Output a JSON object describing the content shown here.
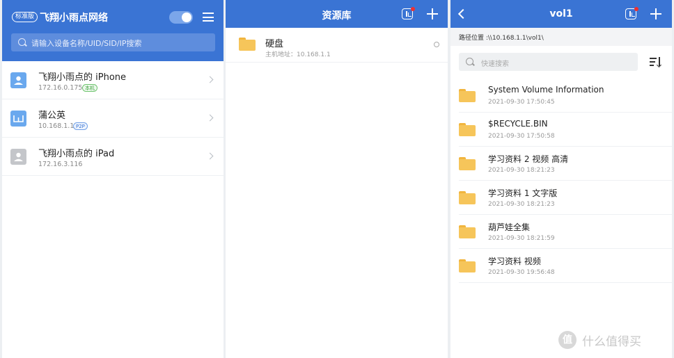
{
  "panel_left": {
    "badge": "标准版",
    "title": "飞翔小雨点网络",
    "search_placeholder": "请输入设备名称/UID/SID/IP搜索",
    "devices": [
      {
        "name": "飞翔小雨点的 iPhone",
        "ip": "172.16.0.175",
        "tag": "本机",
        "tag_color": "green",
        "icon": "phone-icon"
      },
      {
        "name": "蒲公英",
        "ip": "10.168.1.1",
        "tag": "P2P",
        "tag_color": "blue",
        "icon": "router-icon"
      },
      {
        "name": "飞翔小雨点的 iPad",
        "ip": "172.16.3.116",
        "tag": "",
        "tag_color": "",
        "icon": "tablet-icon"
      }
    ]
  },
  "panel_middle": {
    "title": "资源库",
    "disk": {
      "name": "硬盘",
      "host": "主机地址：10.168.1.1"
    }
  },
  "panel_right": {
    "title": "vol1",
    "path": "路径位置 :\\\\10.168.1.1\\vol1\\",
    "search_placeholder": "快速搜索",
    "files": [
      {
        "name": "System Volume Information",
        "date": "2021-09-30 17:50:45"
      },
      {
        "name": "$RECYCLE.BIN",
        "date": "2021-09-30 17:50:58"
      },
      {
        "name": "学习资料 2 视频 高清",
        "date": "2021-09-30 18:21:23"
      },
      {
        "name": "学习资料 1 文字版",
        "date": "2021-09-30 18:21:23"
      },
      {
        "name": "葫芦娃全集",
        "date": "2021-09-30 18:21:59"
      },
      {
        "name": "学习资料 视频",
        "date": "2021-09-30 19:56:48"
      }
    ]
  },
  "watermark": {
    "logo": "值",
    "text": "什么值得买"
  },
  "colors": {
    "accent": "#3a74d4",
    "folder": "#f6c55a",
    "notice_dot": "#ee3030"
  }
}
